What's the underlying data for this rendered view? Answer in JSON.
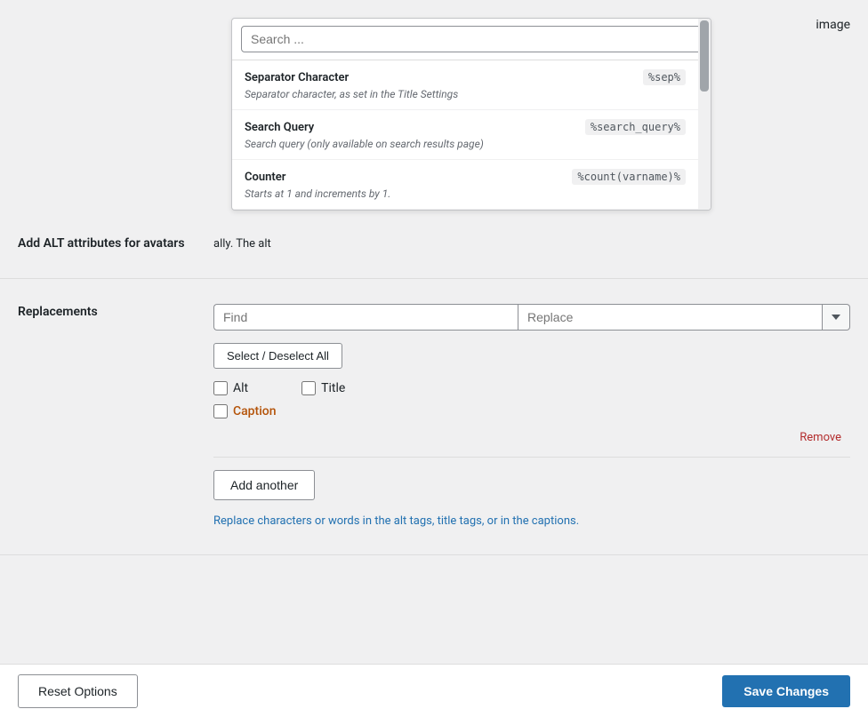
{
  "search": {
    "placeholder": "Search ...",
    "value": ""
  },
  "image_label": "image",
  "dropdown_items": [
    {
      "title": "Separator Character",
      "badge": "%sep%",
      "description": "Separator character, as set in the Title Settings"
    },
    {
      "title": "Search Query",
      "badge": "%search_query%",
      "description": "Search query (only available on search results page)"
    },
    {
      "title": "Counter",
      "badge": "%count(varname)%",
      "description": "Starts at 1 and increments by 1."
    }
  ],
  "alt_attributes": {
    "label": "Add ALT attributes for avatars",
    "description_prefix": "ally. The alt"
  },
  "replacements": {
    "label": "Replacements",
    "find_placeholder": "Find",
    "replace_placeholder": "Replace",
    "select_deselect_label": "Select / Deselect All",
    "checkboxes": [
      {
        "id": "alt",
        "label": "Alt",
        "checked": false
      },
      {
        "id": "title",
        "label": "Title",
        "checked": false
      },
      {
        "id": "caption",
        "label": "Caption",
        "checked": false,
        "special": true
      }
    ],
    "remove_label": "Remove",
    "add_another_label": "Add another",
    "description": "Replace characters or words in the alt tags, title tags, or in the captions."
  },
  "footer": {
    "reset_label": "Reset Options",
    "save_label": "Save Changes"
  }
}
